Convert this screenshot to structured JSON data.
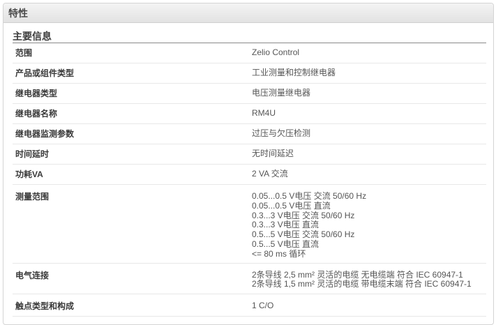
{
  "header": {
    "title": "特性"
  },
  "section": {
    "title": "主要信息"
  },
  "rows": [
    {
      "label": "范围",
      "values": [
        "Zelio Control"
      ]
    },
    {
      "label": "产品或组件类型",
      "values": [
        "工业测量和控制继电器"
      ]
    },
    {
      "label": "继电器类型",
      "values": [
        "电压测量继电器"
      ]
    },
    {
      "label": "继电器名称",
      "values": [
        "RM4U"
      ]
    },
    {
      "label": "继电器监测参数",
      "values": [
        "过压与欠压检测"
      ]
    },
    {
      "label": "时间延时",
      "values": [
        "无时间延迟"
      ]
    },
    {
      "label": "功耗VA",
      "values": [
        "2 VA 交流"
      ]
    },
    {
      "label": "测量范围",
      "values": [
        "0.05...0.5 V电压 交流 50/60 Hz",
        "0.05...0.5 V电压 直流",
        "0.3...3 V电压 交流 50/60 Hz",
        "0.3...3 V电压 直流",
        "0.5...5 V电压 交流 50/60 Hz",
        "0.5...5 V电压 直流",
        "<= 80 ms 循环"
      ]
    },
    {
      "label": "电气连接",
      "values": [
        "2条导线 2,5 mm² 灵活的电缆 无电缆端 符合 IEC 60947-1",
        "2条导线 1,5 mm² 灵活的电缆 带电缆末端 符合 IEC 60947-1"
      ]
    },
    {
      "label": "触点类型和构成",
      "values": [
        "1 C/O"
      ]
    }
  ]
}
